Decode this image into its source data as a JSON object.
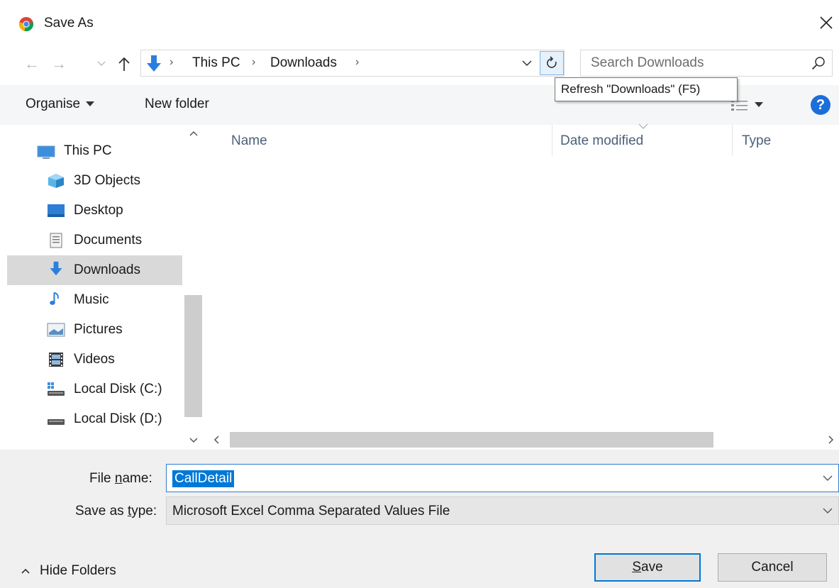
{
  "window": {
    "title": "Save As",
    "app_icon": "chrome-icon"
  },
  "address": {
    "crumbs": [
      "This PC",
      "Downloads"
    ],
    "location_icon": "downloads-arrow-icon"
  },
  "search": {
    "placeholder": "Search Downloads"
  },
  "toolbar": {
    "organise_label": "Organise",
    "new_folder_label": "New folder",
    "help_label": "?"
  },
  "tooltip": {
    "text": "Refresh \"Downloads\" (F5)"
  },
  "nav": {
    "items": [
      {
        "label": "This PC",
        "icon": "pc-icon"
      },
      {
        "label": "3D Objects",
        "icon": "3d-objects-icon"
      },
      {
        "label": "Desktop",
        "icon": "desktop-icon"
      },
      {
        "label": "Documents",
        "icon": "documents-icon"
      },
      {
        "label": "Downloads",
        "icon": "downloads-icon",
        "selected": true
      },
      {
        "label": "Music",
        "icon": "music-icon"
      },
      {
        "label": "Pictures",
        "icon": "pictures-icon"
      },
      {
        "label": "Videos",
        "icon": "videos-icon"
      },
      {
        "label": "Local Disk (C:)",
        "icon": "local-disk-c-icon"
      },
      {
        "label": "Local Disk (D:)",
        "icon": "local-disk-d-icon"
      }
    ]
  },
  "file_list": {
    "columns": [
      "Name",
      "Date modified",
      "Type"
    ]
  },
  "form": {
    "file_name_label_pre": "File ",
    "file_name_label_ul": "n",
    "file_name_label_post": "ame:",
    "file_name_value": "CallDetail",
    "save_type_label_pre": "Save as ",
    "save_type_label_ul": "t",
    "save_type_label_post": "ype:",
    "save_type_value": "Microsoft Excel Comma Separated Values File"
  },
  "footer": {
    "hide_folders_label": "Hide Folders",
    "save_label_ul": "S",
    "save_label_post": "ave",
    "cancel_label": "Cancel"
  },
  "colors": {
    "accent": "#0078d7",
    "selection_bg": "#d9d9d9",
    "bottom_bg": "#f0f0f0"
  }
}
